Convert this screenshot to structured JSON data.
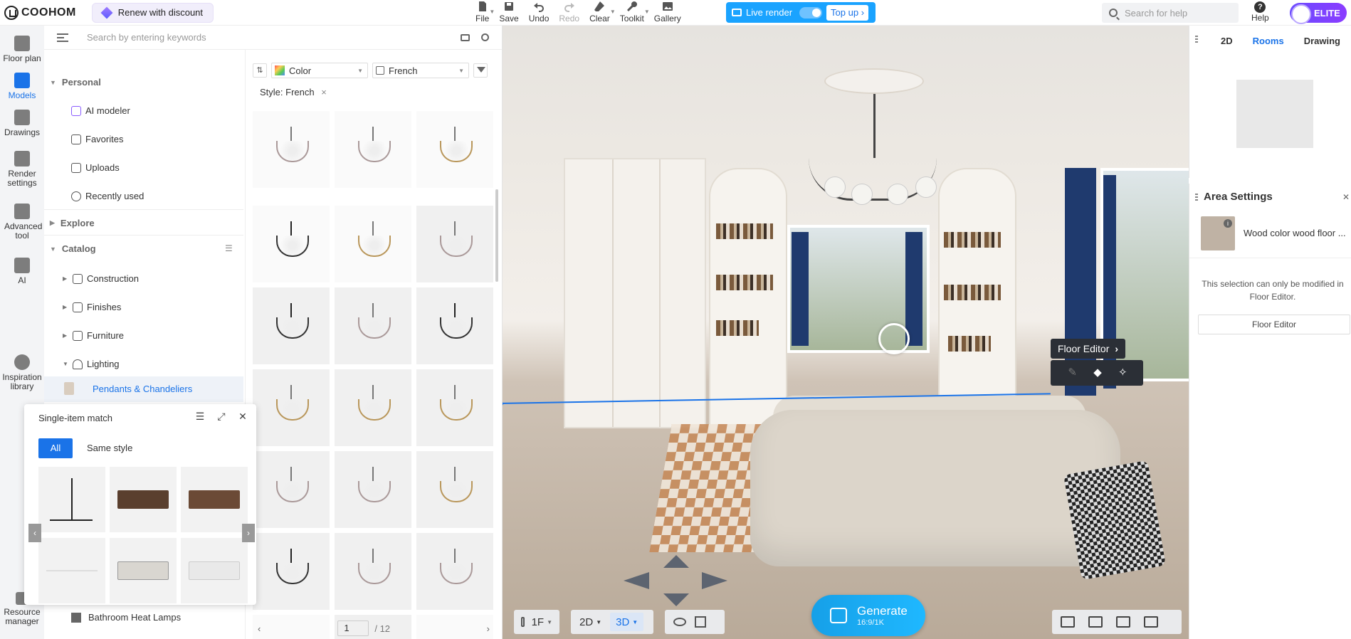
{
  "header": {
    "brand": "COOHOM",
    "renew_label": "Renew with discount",
    "tools": [
      {
        "label": "File",
        "icon": "file-icon",
        "disabled": false
      },
      {
        "label": "Save",
        "icon": "save-icon",
        "disabled": false
      },
      {
        "label": "Undo",
        "icon": "undo-icon",
        "disabled": false
      },
      {
        "label": "Redo",
        "icon": "redo-icon",
        "disabled": true
      },
      {
        "label": "Clear",
        "icon": "eraser-icon",
        "disabled": false
      },
      {
        "label": "Toolkit",
        "icon": "wrench-icon",
        "disabled": false
      },
      {
        "label": "Gallery",
        "icon": "gallery-icon",
        "disabled": false
      }
    ],
    "live_render_label": "Live render",
    "top_up_label": "Top up",
    "search_placeholder": "Search for help",
    "help_label": "Help",
    "elite_label": "ELITE"
  },
  "rail": [
    {
      "label": "Floor plan",
      "active": false
    },
    {
      "label": "Models",
      "active": true
    },
    {
      "label": "Drawings",
      "active": false
    },
    {
      "label": "Render settings",
      "active": false
    },
    {
      "label": "Advanced tool",
      "active": false
    },
    {
      "label": "AI",
      "active": false
    },
    {
      "label": "Inspiration library",
      "active": false
    },
    {
      "label": "Resource manager",
      "active": false
    }
  ],
  "panel": {
    "search_placeholder": "Search by entering keywords",
    "sections": {
      "personal": "Personal",
      "explore": "Explore",
      "catalog": "Catalog"
    },
    "personal_items": [
      "AI modeler",
      "Favorites",
      "Uploads",
      "Recently used"
    ],
    "catalog_items": [
      "Construction",
      "Finishes",
      "Furniture",
      "Lighting"
    ],
    "selected_item": "Pendants & Chandeliers",
    "last_item": "Bathroom Heat Lamps",
    "filters": {
      "color": "Color",
      "style": "French"
    },
    "style_tag": "Style: French",
    "style_tag_close": "×",
    "page_current": "1",
    "page_total": "/ 12",
    "page_prev": "‹",
    "page_next": "›"
  },
  "single_match": {
    "title": "Single-item match",
    "tab_all": "All",
    "tab_same": "Same style",
    "prev": "‹",
    "next": "›"
  },
  "viewport": {
    "floor_editor_tip": "Floor Editor",
    "floor_label": "1F",
    "mode_2d": "2D",
    "mode_3d": "3D",
    "generate_label": "Generate",
    "generate_sub": "16:9/1K"
  },
  "right_panel": {
    "tabs": [
      "2D",
      "Rooms",
      "Drawing"
    ],
    "active_tab": "Rooms",
    "area_title": "Area Settings",
    "material_name": "Wood color wood floor ...",
    "note": "This selection can only be modified in Floor Editor.",
    "floor_editor_button": "Floor Editor"
  }
}
